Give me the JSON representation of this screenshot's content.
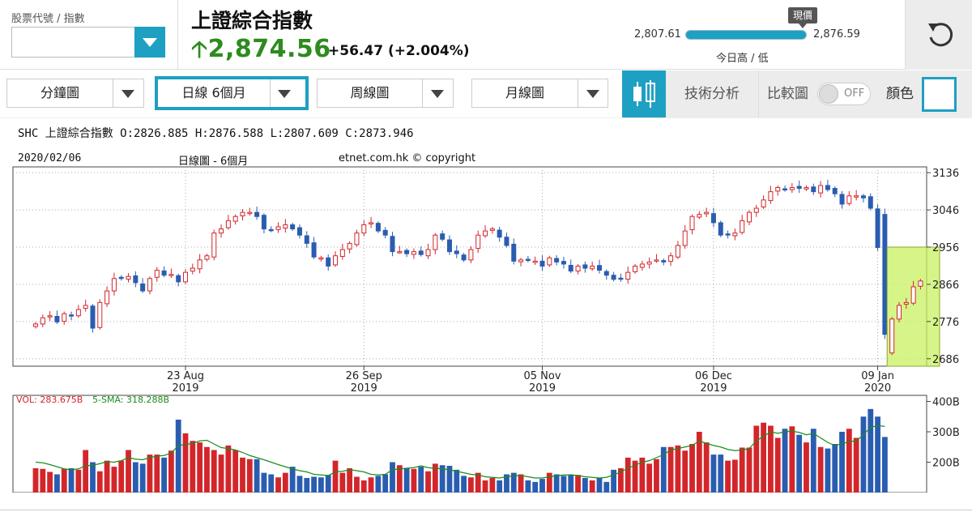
{
  "header": {
    "code_label": "股票代號 / 指數",
    "code_value": "",
    "title": "上證綜合指數",
    "price": "2,874.56",
    "change": "+56.47",
    "change_pct": "(+2.004%)",
    "price_color": "#2e8b1f",
    "range_low": "2,807.61",
    "range_high": "2,876.59",
    "range_marker": "現價",
    "range_position": 0.97,
    "range_caption": "今日高 / 低"
  },
  "toolbar": {
    "minute": "分鐘圖",
    "daily": "日線 6個月",
    "weekly": "周線圖",
    "monthly": "月線圖",
    "tech": "技術分析",
    "compare": "比較圖",
    "compare_toggle": "OFF",
    "color": "顏色",
    "accent": "#1ea0c3"
  },
  "chart": {
    "ohlc_text": "SHC 上證綜合指數 O:2826.885 H:2876.588 L:2807.609 C:2873.946",
    "date": "2020/02/06",
    "type_label": "日線圖 - 6個月",
    "copyright": "etnet.com.hk © copyright",
    "vol_label": "VOL: 283.675B",
    "sma_label": "5-SMA: 318.288B",
    "vol_ticks": [
      "400B",
      "300B",
      "200B"
    ],
    "up_color": "#d2262b",
    "down_color": "#2a5db0",
    "highlight_color": "#c8f060"
  },
  "chart_data": {
    "type": "candlestick",
    "ylim": [
      2668,
      3150
    ],
    "yticks": [
      3136,
      3046,
      2956,
      2866,
      2776,
      2686
    ],
    "xticks": [
      {
        "i": 21,
        "d": "23 Aug",
        "y": "2019"
      },
      {
        "i": 46,
        "d": "26 Sep",
        "y": "2019"
      },
      {
        "i": 71,
        "d": "05 Nov",
        "y": "2019"
      },
      {
        "i": 95,
        "d": "06 Dec",
        "y": "2019"
      },
      {
        "i": 118,
        "d": "09 Jan",
        "y": "2020"
      }
    ],
    "closes": [
      2770,
      2785,
      2790,
      2775,
      2795,
      2790,
      2805,
      2815,
      2760,
      2822,
      2850,
      2880,
      2880,
      2885,
      2870,
      2850,
      2880,
      2900,
      2888,
      2890,
      2872,
      2895,
      2905,
      2925,
      2935,
      2990,
      3000,
      3020,
      3030,
      3040,
      3040,
      3030,
      3000,
      2997,
      3005,
      3010,
      3000,
      2985,
      2965,
      2932,
      2930,
      2910,
      2935,
      2950,
      2965,
      2990,
      3010,
      3015,
      2995,
      2985,
      2945,
      2945,
      2940,
      2945,
      2938,
      2950,
      2985,
      2975,
      2945,
      2940,
      2925,
      2950,
      2985,
      2995,
      3000,
      2980,
      2960,
      2922,
      2925,
      2924,
      2922,
      2910,
      2930,
      2920,
      2915,
      2898,
      2910,
      2905,
      2910,
      2900,
      2888,
      2878,
      2880,
      2895,
      2910,
      2915,
      2920,
      2925,
      2920,
      2935,
      2960,
      2995,
      3030,
      3035,
      3040,
      3015,
      2985,
      2985,
      2990,
      3020,
      3040,
      3050,
      3070,
      3090,
      3100,
      3095,
      3100,
      3098,
      3100,
      3090,
      3105,
      3095,
      3085,
      3060,
      3080,
      3080,
      3075,
      3050,
      2955,
      2745,
      2782,
      2815,
      2822,
      2860,
      2874
    ],
    "volumes": [
      180,
      178,
      168,
      160,
      178,
      180,
      175,
      240,
      200,
      170,
      205,
      185,
      205,
      240,
      200,
      195,
      225,
      225,
      215,
      238,
      340,
      295,
      270,
      265,
      250,
      240,
      225,
      255,
      240,
      215,
      210,
      210,
      165,
      160,
      150,
      165,
      185,
      155,
      148,
      152,
      150,
      158,
      205,
      165,
      180,
      152,
      140,
      150,
      155,
      160,
      200,
      190,
      180,
      178,
      185,
      170,
      195,
      190,
      188,
      175,
      155,
      150,
      165,
      140,
      148,
      140,
      160,
      165,
      160,
      140,
      135,
      145,
      165,
      160,
      155,
      160,
      158,
      148,
      140,
      148,
      135,
      175,
      180,
      215,
      205,
      215,
      195,
      210,
      250,
      250,
      255,
      238,
      260,
      300,
      265,
      225,
      225,
      205,
      208,
      248,
      248,
      320,
      330,
      320,
      280,
      310,
      318,
      290,
      265,
      310,
      250,
      245,
      260,
      300,
      310,
      280,
      350,
      375,
      350,
      283
    ],
    "sma": [
      200,
      198,
      192,
      185,
      178,
      175,
      178,
      188,
      190,
      195,
      202,
      200,
      205,
      215,
      210,
      208,
      215,
      220,
      222,
      230,
      255,
      258,
      262,
      270,
      272,
      260,
      248,
      245,
      240,
      232,
      222,
      215,
      208,
      200,
      192,
      185,
      178,
      172,
      168,
      160,
      158,
      156,
      168,
      170,
      175,
      172,
      168,
      160,
      158,
      160,
      175,
      178,
      180,
      182,
      188,
      182,
      180,
      178,
      175,
      170,
      165,
      160,
      158,
      152,
      150,
      148,
      152,
      155,
      156,
      152,
      148,
      148,
      152,
      155,
      158,
      158,
      156,
      152,
      150,
      148,
      150,
      158,
      168,
      180,
      190,
      200,
      205,
      215,
      225,
      240,
      245,
      250,
      255,
      270,
      262,
      255,
      250,
      242,
      238,
      240,
      245,
      270,
      285,
      300,
      295,
      300,
      302,
      298,
      290,
      295,
      280,
      265,
      255,
      260,
      268,
      270,
      290,
      315,
      320,
      318
    ]
  }
}
